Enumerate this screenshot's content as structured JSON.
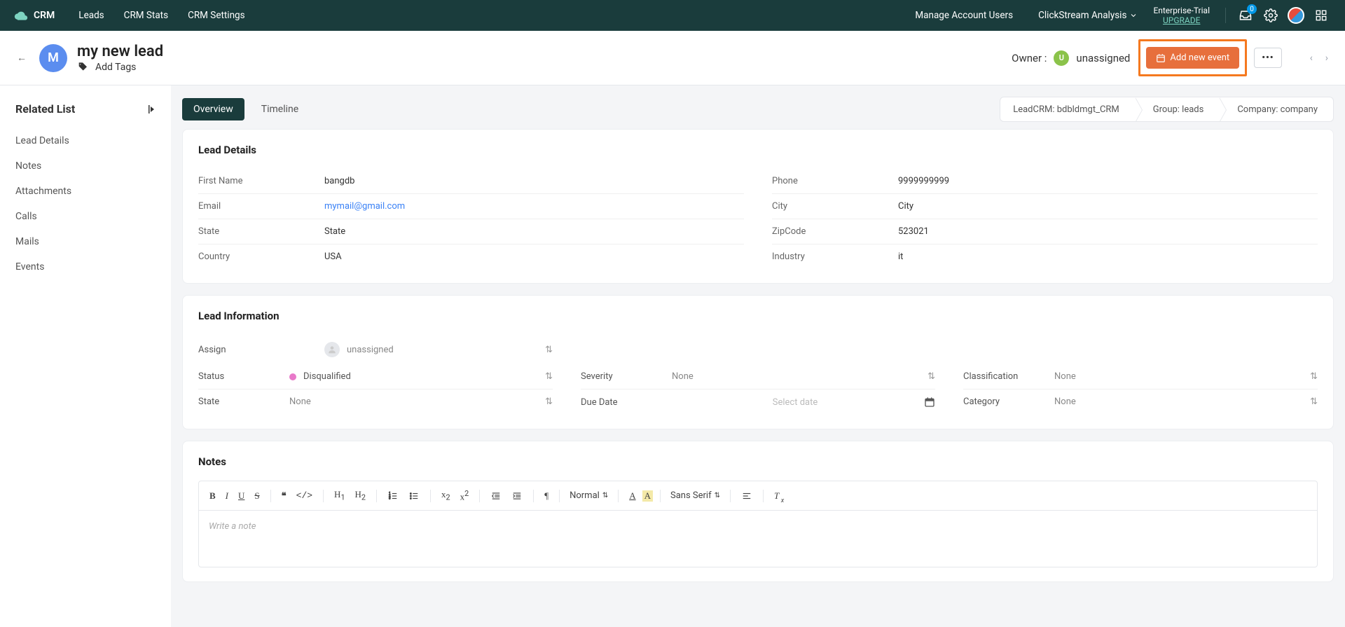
{
  "topnav": {
    "brand": "CRM",
    "items": [
      "Leads",
      "CRM Stats",
      "CRM Settings"
    ],
    "rightItems": [
      "Manage Account Users",
      "ClickStream Analysis"
    ],
    "enterprise": {
      "line1": "Enterprise-Trial",
      "upgrade": "UPGRADE"
    },
    "badgeCount": "0"
  },
  "header": {
    "avatarLetter": "M",
    "title": "my new lead",
    "addTags": "Add Tags",
    "ownerLabel": "Owner :",
    "ownerLetter": "U",
    "ownerName": "unassigned",
    "addEvent": "Add new event",
    "more": "•••"
  },
  "sidebar": {
    "title": "Related List",
    "items": [
      "Lead Details",
      "Notes",
      "Attachments",
      "Calls",
      "Mails",
      "Events"
    ]
  },
  "tabs": {
    "overview": "Overview",
    "timeline": "Timeline"
  },
  "breadcrumb": {
    "crm": "LeadCRM: bdbldmgt_CRM",
    "group": "Group: leads",
    "company": "Company: company"
  },
  "leadDetails": {
    "heading": "Lead Details",
    "left": [
      {
        "label": "First Name",
        "value": "bangdb"
      },
      {
        "label": "Email",
        "value": "mymail@gmail.com",
        "link": true
      },
      {
        "label": "State",
        "value": "State"
      },
      {
        "label": "Country",
        "value": "USA"
      }
    ],
    "right": [
      {
        "label": "Phone",
        "value": "9999999999"
      },
      {
        "label": "City",
        "value": "City"
      },
      {
        "label": "ZipCode",
        "value": "523021"
      },
      {
        "label": "Industry",
        "value": "it"
      }
    ]
  },
  "leadInfo": {
    "heading": "Lead Information",
    "assign": {
      "label": "Assign",
      "value": "unassigned"
    },
    "status": {
      "label": "Status",
      "value": "Disqualified"
    },
    "state": {
      "label": "State",
      "value": "None"
    },
    "severity": {
      "label": "Severity",
      "value": "None"
    },
    "dueDate": {
      "label": "Due Date",
      "placeholder": "Select date"
    },
    "classification": {
      "label": "Classification",
      "value": "None"
    },
    "category": {
      "label": "Category",
      "value": "None"
    }
  },
  "notes": {
    "heading": "Notes",
    "placeholder": "Write a note",
    "sizeNormal": "Normal",
    "fontSans": "Sans Serif"
  }
}
